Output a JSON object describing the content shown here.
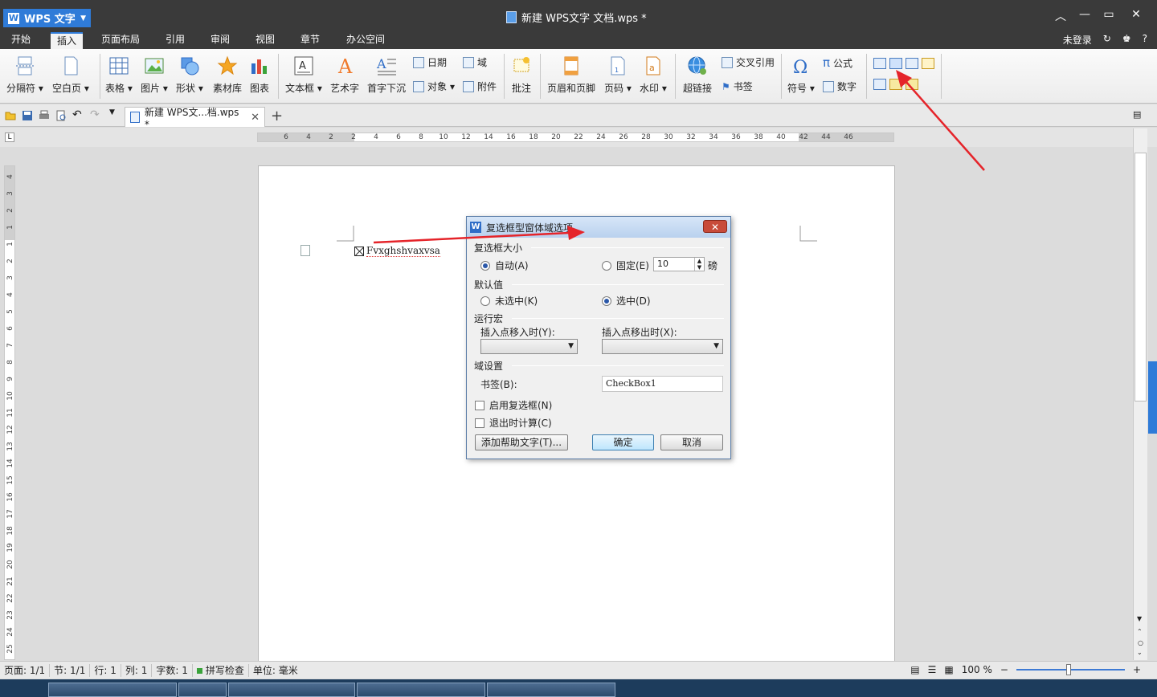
{
  "app": {
    "name": "WPS 文字",
    "doc_title": "新建 WPS文字 文档.wps *",
    "window_controls": [
      "chevron-up-icon",
      "minimize-icon",
      "maximize-icon",
      "close-icon"
    ]
  },
  "menu": {
    "tabs": [
      "开始",
      "插入",
      "页面布局",
      "引用",
      "审阅",
      "视图",
      "章节",
      "办公空间"
    ],
    "active_tab": "插入",
    "login": "未登录",
    "help": "?"
  },
  "ribbon": {
    "groups": [
      {
        "label": "分隔符",
        "icon": "page-break-icon",
        "dropdown": true
      },
      {
        "label": "空白页",
        "icon": "blank-page-icon",
        "dropdown": true
      },
      {
        "label": "表格",
        "icon": "table-icon",
        "dropdown": true
      },
      {
        "label": "图片",
        "icon": "picture-icon",
        "dropdown": true
      },
      {
        "label": "形状",
        "icon": "shapes-icon",
        "dropdown": true
      },
      {
        "label": "素材库",
        "icon": "star-icon",
        "dropdown": false
      },
      {
        "label": "图表",
        "icon": "chart-icon",
        "dropdown": false
      },
      {
        "label": "文本框",
        "icon": "textbox-icon",
        "dropdown": true
      },
      {
        "label": "艺术字",
        "icon": "wordart-icon",
        "dropdown": true
      },
      {
        "label": "首字下沉",
        "icon": "dropcap-icon",
        "dropdown": false
      },
      {
        "label": "批注",
        "icon": "comment-icon",
        "dropdown": false
      },
      {
        "label": "页眉和页脚",
        "icon": "header-footer-icon",
        "dropdown": false
      },
      {
        "label": "页码",
        "icon": "page-number-icon",
        "dropdown": true
      },
      {
        "label": "水印",
        "icon": "watermark-icon",
        "dropdown": true
      },
      {
        "label": "超链接",
        "icon": "hyperlink-icon",
        "dropdown": false
      },
      {
        "label": "符号",
        "icon": "omega-icon",
        "dropdown": true
      }
    ],
    "small": {
      "date": "日期",
      "field": "域",
      "object": "对象",
      "attachment": "附件",
      "cross_ref": "交叉引用",
      "bookmark": "书签",
      "formula": "公式",
      "number": "数字"
    }
  },
  "tabs": {
    "doc_tab": "新建 WPS文...档.wps *"
  },
  "ruler": {
    "h_ticks": [
      "6",
      "4",
      "2",
      "2",
      "4",
      "6",
      "8",
      "10",
      "12",
      "14",
      "16",
      "18",
      "20",
      "22",
      "24",
      "26",
      "28",
      "30",
      "32",
      "34",
      "36",
      "38",
      "40",
      "42",
      "44",
      "46"
    ],
    "v_ticks": [
      "4",
      "3",
      "2",
      "1",
      "1",
      "2",
      "3",
      "4",
      "5",
      "6",
      "7",
      "8",
      "9",
      "10",
      "11",
      "12",
      "13",
      "14",
      "15",
      "16",
      "17",
      "18",
      "19",
      "20",
      "21",
      "22",
      "23",
      "24",
      "25"
    ]
  },
  "document": {
    "checkbox_text": "Fvxghshvaxvsa"
  },
  "dialog": {
    "title": "复选框型窗体域选项",
    "size_group": "复选框大小",
    "auto": "自动(A)",
    "fixed": "固定(E)",
    "fixed_value": "10",
    "unit": "磅",
    "size_mode": "auto",
    "default_group": "默认值",
    "unchecked": "未选中(K)",
    "checked": "选中(D)",
    "default_value": "checked",
    "macro_group": "运行宏",
    "entry": "插入点移入时(Y):",
    "exit": "插入点移出时(X):",
    "field_group": "域设置",
    "bookmark_label": "书签(B):",
    "bookmark_value": "CheckBox1",
    "enable_check": "启用复选框(N)",
    "calc_on_exit": "退出时计算(C)",
    "help_button": "添加帮助文字(T)...",
    "ok": "确定",
    "cancel": "取消"
  },
  "status": {
    "page": "页面: 1/1",
    "section": "节: 1/1",
    "line": "行: 1",
    "column": "列: 1",
    "words": "字数: 1",
    "spell": "拼写检查",
    "unit": "单位: 毫米",
    "zoom": "100 %",
    "zoom_level": 0.48
  },
  "colors": {
    "accent": "#2f7bd8",
    "titlebar": "#3a3a3a",
    "arrow": "#e5242a"
  }
}
